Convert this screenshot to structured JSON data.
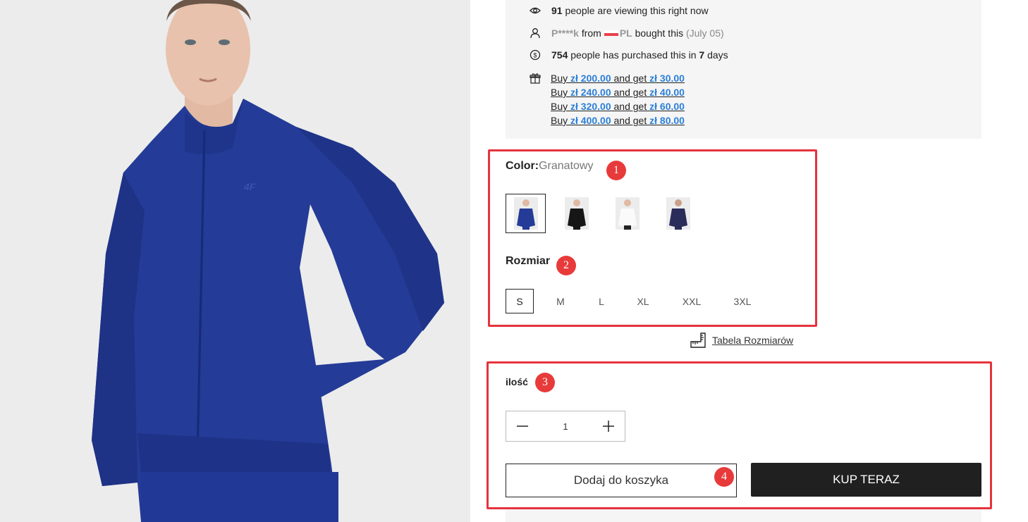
{
  "social_proof": {
    "viewing_count": "91",
    "viewing_text": "people are viewing this right now",
    "buyer_name": "P****k",
    "buyer_from": "from",
    "buyer_country": "PL",
    "buyer_text": "bought this",
    "buyer_date": "(July 05)",
    "purchased_count": "754",
    "purchased_text": "people has purchased this in",
    "purchased_days": "7",
    "purchased_days_unit": "days"
  },
  "promotions": [
    {
      "prefix": "Buy ",
      "spend": "zł 200.00",
      "middle": " and get ",
      "reward": "zł 30.00"
    },
    {
      "prefix": "Buy ",
      "spend": "zł 240.00",
      "middle": " and get ",
      "reward": "zł 40.00"
    },
    {
      "prefix": "Buy ",
      "spend": "zł 320.00",
      "middle": " and get ",
      "reward": "zł 60.00"
    },
    {
      "prefix": "Buy ",
      "spend": "zł 400.00",
      "middle": " and get ",
      "reward": "zł 80.00"
    }
  ],
  "color": {
    "label": "Color:",
    "selected_value": "Granatowy",
    "swatches": [
      "blue",
      "black",
      "white",
      "navy"
    ]
  },
  "size": {
    "label": "Rozmiar",
    "options": [
      "S",
      "M",
      "L",
      "XL",
      "XXL",
      "3XL"
    ],
    "selected": "S",
    "table_link": "Tabela Rozmiarów"
  },
  "quantity": {
    "label": "ilość",
    "value": "1"
  },
  "actions": {
    "add_to_cart": "Dodaj do koszyka",
    "buy_now": "KUP TERAZ"
  },
  "annotations": [
    "1",
    "2",
    "3",
    "4"
  ],
  "brand_logo": "4F",
  "colors": {
    "accent_link": "#2b7fd8",
    "highlight": "#e5333d",
    "badge": "#e83a3a",
    "jacket": "#233a94",
    "buy_button": "#202020"
  }
}
